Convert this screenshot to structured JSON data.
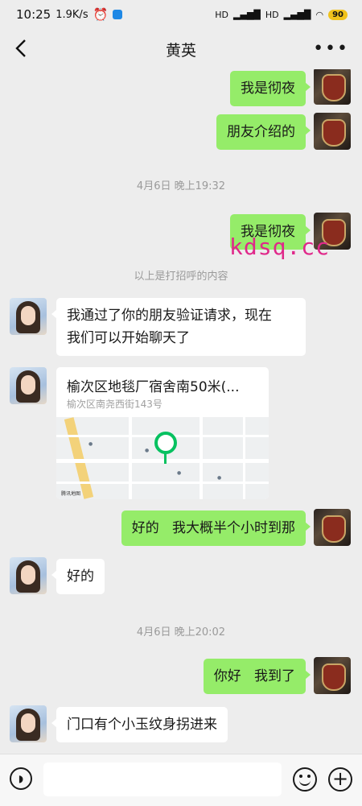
{
  "status_bar": {
    "time": "10:25",
    "network_speed": "1.9K/s",
    "battery": "90",
    "icons": [
      "alarm-icon",
      "app-notification-icon",
      "hd-signal-icon",
      "signal-icon",
      "wifi-icon",
      "battery-icon"
    ]
  },
  "header": {
    "title": "黄英",
    "back_icon": "chevron-left-icon",
    "more_icon": "more-dots-icon"
  },
  "chat": {
    "messages": [
      {
        "side": "out",
        "type": "text",
        "text": "我是彻夜"
      },
      {
        "side": "out",
        "type": "text",
        "text": "朋友介绍的"
      },
      {
        "type": "timestamp",
        "text": "4月6日 晚上19:32"
      },
      {
        "side": "out",
        "type": "text",
        "text": "我是彻夜"
      },
      {
        "type": "system",
        "text": "以上是打招呼的内容"
      },
      {
        "side": "in",
        "type": "text",
        "lines": [
          "我通过了你的朋友验证请求，现在",
          "我们可以开始聊天了"
        ]
      },
      {
        "side": "in",
        "type": "location",
        "title": "榆次区地毯厂宿舍南50米(...",
        "address": "榆次区南尧西街143号",
        "map_logo": "腾讯地图"
      },
      {
        "side": "out",
        "type": "text",
        "text": "好的   我大概半个小时到那"
      },
      {
        "side": "in",
        "type": "text",
        "text": "好的"
      },
      {
        "type": "timestamp",
        "text": "4月6日 晚上20:02"
      },
      {
        "side": "out",
        "type": "text",
        "text": "你好   我到了"
      },
      {
        "side": "in",
        "type": "text",
        "text": "门口有个小玉纹身拐进来"
      }
    ]
  },
  "watermark": "kdsq.cc",
  "input_bar": {
    "voice_icon": "voice-icon",
    "emoji_icon": "emoji-icon",
    "plus_icon": "plus-icon"
  },
  "colors": {
    "background": "#ededed",
    "outgoing_bubble": "#95ec69",
    "incoming_bubble": "#ffffff",
    "location_pin": "#07c160",
    "watermark": "#e0288a"
  }
}
